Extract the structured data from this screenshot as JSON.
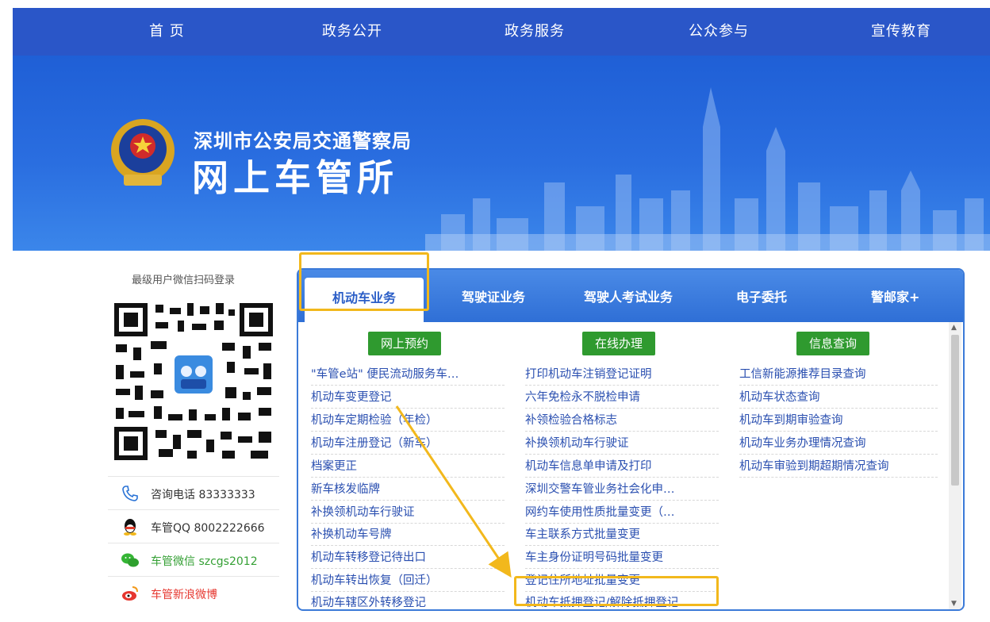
{
  "topnav": {
    "items": [
      "首 页",
      "政务公开",
      "政务服务",
      "公众参与",
      "宣传教育"
    ]
  },
  "banner": {
    "subtitle": "深圳市公安局交通警察局",
    "title": "网上车管所"
  },
  "sidebar": {
    "qr_title": "最级用户微信扫码登录",
    "contacts": [
      {
        "icon": "phone-icon",
        "text": "咨询电话 83333333"
      },
      {
        "icon": "qq-icon",
        "text": "车管QQ 8002222666"
      },
      {
        "icon": "wechat-icon",
        "text": "车管微信 szcgs2012"
      },
      {
        "icon": "weibo-icon",
        "text": "车管新浪微博"
      }
    ]
  },
  "tabs": [
    "机动车业务",
    "驾驶证业务",
    "驾驶人考试业务",
    "电子委托",
    "警邮家+"
  ],
  "sections": {
    "online_booking": {
      "label": "网上预约",
      "links": [
        "\"车管e站\" 便民流动服务车…",
        "机动车变更登记",
        "机动车定期检验（年检）",
        "机动车注册登记（新车）",
        "档案更正",
        "新车核发临牌",
        "补换领机动车行驶证",
        "补换机动车号牌",
        "机动车转移登记待出口",
        "机动车转出恢复（回迁）",
        "机动车辖区外转移登记"
      ]
    },
    "online_handle": {
      "label": "在线办理",
      "links": [
        "打印机动车注销登记证明",
        "六年免检永不脱检申请",
        "补领检验合格标志",
        "补换领机动车行驶证",
        "机动车信息单申请及打印",
        "深圳交警车管业务社会化申…",
        "网约车使用性质批量变更（…",
        "车主联系方式批量变更",
        "车主身份证明号码批量变更",
        "登记住所地址批量变更",
        "机动车抵押登记/解除抵押登记"
      ]
    },
    "info_query": {
      "label": "信息查询",
      "links": [
        "工信新能源推荐目录查询",
        "机动车状态查询",
        "机动车到期审验查询",
        "机动车业务办理情况查询",
        "机动车审验到期超期情况查询"
      ]
    }
  },
  "colors": {
    "nav_blue": "#2a56c8",
    "link_blue": "#2a4fb0",
    "section_green": "#2f9a2f",
    "highlight_yellow": "#f2b81c"
  }
}
